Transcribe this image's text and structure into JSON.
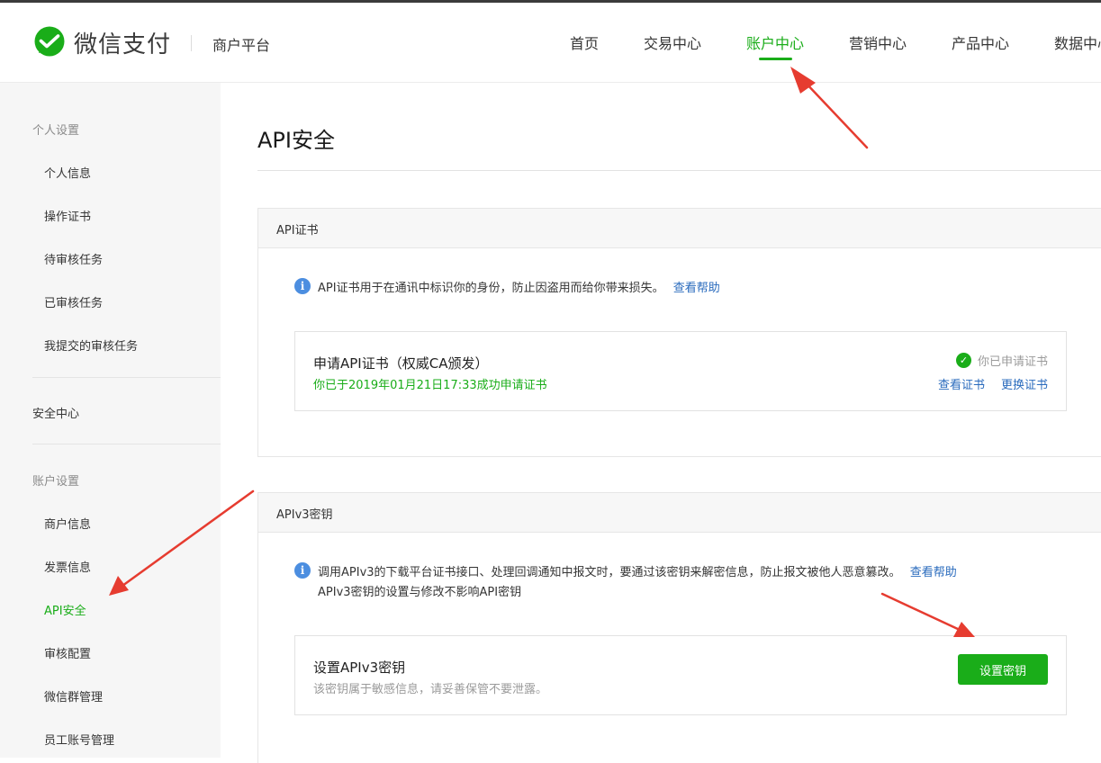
{
  "header": {
    "brand": "微信支付",
    "platform": "商户平台",
    "nav": [
      {
        "label": "首页"
      },
      {
        "label": "交易中心"
      },
      {
        "label": "账户中心",
        "active": true
      },
      {
        "label": "营销中心"
      },
      {
        "label": "产品中心"
      },
      {
        "label": "数据中心"
      }
    ]
  },
  "sidebar": {
    "personal_group": "个人设置",
    "personal_items": [
      "个人信息",
      "操作证书",
      "待审核任务",
      "已审核任务",
      "我提交的审核任务"
    ],
    "security_center": "安全中心",
    "account_group": "账户设置",
    "account_items": [
      "商户信息",
      "发票信息",
      "API安全",
      "审核配置",
      "微信群管理",
      "员工账号管理"
    ],
    "active_item": "API安全"
  },
  "main": {
    "title": "API安全",
    "api_cert": {
      "heading": "API证书",
      "info": "API证书用于在通讯中标识你的身份，防止因盗用而给你带来损失。",
      "help_link": "查看帮助",
      "card_title": "申请API证书（权威CA颁发）",
      "card_subtitle": "你已于2019年01月21日17:33成功申请证书",
      "status": "你已申请证书",
      "view_link": "查看证书",
      "replace_link": "更换证书"
    },
    "apiv3": {
      "heading": "APIv3密钥",
      "info_line1": "调用APIv3的下载平台证书接口、处理回调通知中报文时，要通过该密钥来解密信息，防止报文被他人恶意篡改。",
      "help_link": "查看帮助",
      "info_line2": "APIv3密钥的设置与修改不影响API密钥",
      "card_title": "设置APIv3密钥",
      "card_subtitle": "该密钥属于敏感信息，请妥善保管不要泄露。",
      "button_label": "设置密钥"
    }
  },
  "colors": {
    "accent_green": "#1aad19",
    "link_blue": "#2a6bbd",
    "info_blue": "#4c8ee0",
    "annotation_red": "#e63c30"
  },
  "icons": {
    "logo": "wechat-pay-logo-icon",
    "info": "info-icon",
    "status": "check-circle-icon"
  }
}
